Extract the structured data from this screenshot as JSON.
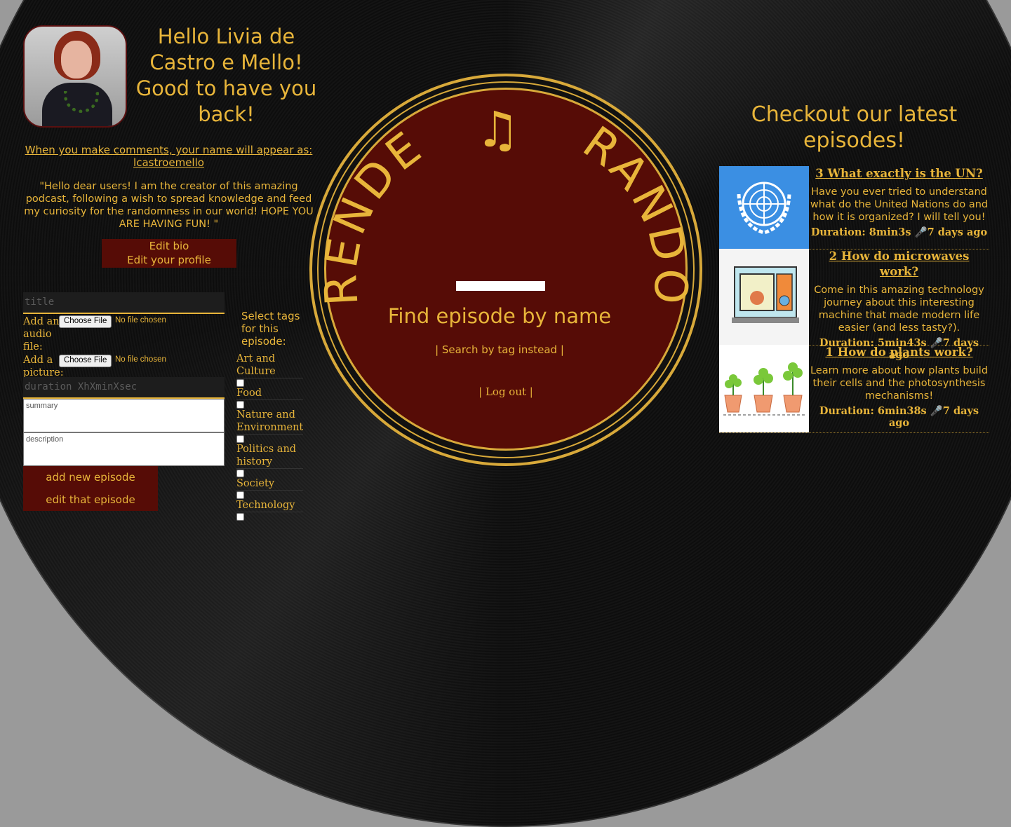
{
  "greeting": "Hello Livia de Castro e Mello! Good to have you back!",
  "comment_note": "When you make comments, your name will appear as: lcastroemello",
  "bio": "\"Hello dear users! I am the creator of this amazing podcast, following a wish to spread knowledge and feed my curiosity for the randomness in our world! HOPE YOU ARE HAVING FUN! \"",
  "buttons": {
    "edit_bio": "Edit bio",
    "edit_profile": "Edit your profile",
    "add_episode": "add new episode",
    "edit_episode": "edit that episode"
  },
  "form": {
    "title_placeholder": "title",
    "audio_label": "Add an audio file:",
    "picture_label": "Add a picture:",
    "choose_file": "Choose File",
    "no_file": "No file chosen",
    "duration_placeholder": "duration XhXminXsec",
    "summary_placeholder": "summary",
    "description_placeholder": "description"
  },
  "tags": {
    "heading": "Select tags for this episode:",
    "items": [
      "Art and Culture",
      "Food",
      "Nature and Environment",
      "Politics and history",
      "Society",
      "Technology"
    ]
  },
  "center": {
    "title_left": "RENDER",
    "title_right": "RANDOM",
    "note_icon": "♫",
    "find_text": "Find episode by name",
    "tag_link": "| Search by tag instead |",
    "logout": "| Log out |"
  },
  "latest": {
    "heading": "Checkout our latest episodes!",
    "episodes": [
      {
        "title": "3 What exactly is the UN?",
        "summary": "Have you ever tried to understand what do the United Nations do and how it is organized? I will tell you!",
        "meta": "Duration: 8min3s 🎤7 days ago",
        "thumb": "un-logo-thumbnail"
      },
      {
        "title": "2 How do microwaves work?",
        "summary": "Come in this amazing technology journey about this interesting machine that made modern life easier (and less tasty?).",
        "meta": "Duration: 5min43s 🎤7 days ago",
        "thumb": "microwave-thumbnail"
      },
      {
        "title": "1 How do plants work?",
        "summary": "Learn more about how plants build their cells and the photosynthesis mechanisms!",
        "meta": "Duration: 6min38s 🎤7 days ago",
        "thumb": "plants-thumbnail"
      }
    ]
  },
  "colors": {
    "gold": "#e8b53a",
    "maroon": "#560c06",
    "un_blue": "#3b8fe3"
  }
}
